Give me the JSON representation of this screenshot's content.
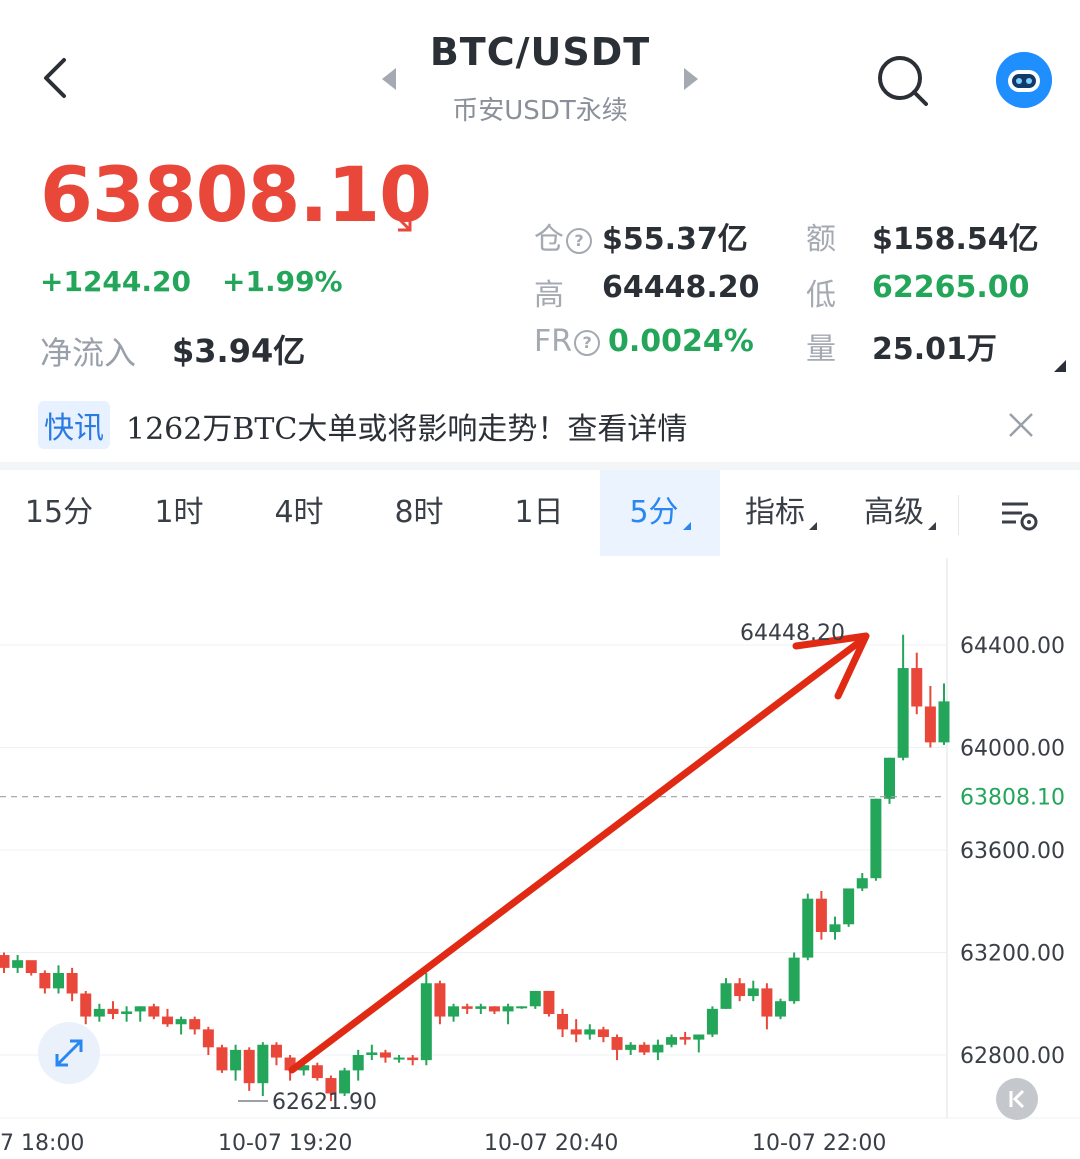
{
  "header": {
    "pair": "BTC/USDT",
    "exchange": "币安USDT永续"
  },
  "price": {
    "last": "63808.10",
    "change_abs": "+1244.20",
    "change_pct": "+1.99%",
    "netflow_label": "净流入",
    "netflow_value": "$3.94亿"
  },
  "stats": {
    "oi_label": "仓",
    "oi_value": "$55.37亿",
    "amount_label": "额",
    "amount_value": "$158.54亿",
    "high_label": "高",
    "high_value": "64448.20",
    "low_label": "低",
    "low_value": "62265.00",
    "fr_label": "FR",
    "fr_value": "0.0024%",
    "vol_label": "量",
    "vol_value": "25.01万"
  },
  "news": {
    "tag": "快讯",
    "text": "1262万BTC大单或将影响走势！查看详情"
  },
  "tabs": {
    "t15m": "15分",
    "t1h": "1时",
    "t4h": "4时",
    "t8h": "8时",
    "t1d": "1日",
    "t5m": "5分",
    "indicators": "指标",
    "advanced": "高级"
  },
  "colors": {
    "up": "#23a55a",
    "down": "#e8473a",
    "accent": "#2a86f0"
  },
  "chart_data": {
    "type": "candlestick",
    "y_ticks": [
      "64400.00",
      "64000.00",
      "63600.00",
      "63200.00",
      "62800.00"
    ],
    "y_tick_values": [
      64400,
      64000,
      63600,
      63200,
      62800
    ],
    "x_ticks": [
      "7 18:00",
      "10-07 19:20",
      "10-07 20:40",
      "10-07 22:00"
    ],
    "last_price_line": "63808.10",
    "high_marker": "64448.20",
    "low_marker": "62621.90",
    "ylim": [
      62580,
      64620
    ],
    "candles": [
      [
        63190,
        63200,
        63120,
        63140
      ],
      [
        63140,
        63190,
        63120,
        63170
      ],
      [
        63170,
        63160,
        63110,
        63120
      ],
      [
        63120,
        63130,
        63040,
        63060
      ],
      [
        63060,
        63150,
        63040,
        63120
      ],
      [
        63120,
        63140,
        63010,
        63040
      ],
      [
        63040,
        63050,
        62920,
        62950
      ],
      [
        62950,
        63000,
        62930,
        62980
      ],
      [
        62980,
        63010,
        62940,
        62960
      ],
      [
        62960,
        62990,
        62930,
        62970
      ],
      [
        62970,
        62990,
        62930,
        62990
      ],
      [
        62990,
        63000,
        62940,
        62950
      ],
      [
        62950,
        62980,
        62910,
        62920
      ],
      [
        62920,
        62950,
        62880,
        62940
      ],
      [
        62940,
        62950,
        62880,
        62900
      ],
      [
        62900,
        62910,
        62800,
        62830
      ],
      [
        62830,
        62840,
        62730,
        62740
      ],
      [
        62740,
        62840,
        62700,
        62820
      ],
      [
        62820,
        62830,
        62660,
        62690
      ],
      [
        62690,
        62850,
        62640,
        62840
      ],
      [
        62840,
        62850,
        62760,
        62790
      ],
      [
        62790,
        62800,
        62700,
        62740
      ],
      [
        62740,
        62780,
        62720,
        62760
      ],
      [
        62760,
        62770,
        62700,
        62710
      ],
      [
        62710,
        62720,
        62620,
        62650
      ],
      [
        62650,
        62750,
        62640,
        62740
      ],
      [
        62740,
        62820,
        62700,
        62800
      ],
      [
        62800,
        62840,
        62780,
        62810
      ],
      [
        62810,
        62820,
        62770,
        62790
      ],
      [
        62790,
        62800,
        62770,
        62790
      ],
      [
        62790,
        62800,
        62760,
        62780
      ],
      [
        62780,
        63120,
        62760,
        63080
      ],
      [
        63080,
        63090,
        62920,
        62950
      ],
      [
        62950,
        63000,
        62930,
        62990
      ],
      [
        62990,
        63000,
        62960,
        62980
      ],
      [
        62980,
        63000,
        62960,
        62990
      ],
      [
        62990,
        62990,
        62960,
        62970
      ],
      [
        62970,
        63000,
        62920,
        62990
      ],
      [
        62990,
        62990,
        62980,
        62990
      ],
      [
        62990,
        63050,
        62980,
        63050
      ],
      [
        63050,
        63050,
        62950,
        62960
      ],
      [
        62960,
        62980,
        62870,
        62900
      ],
      [
        62900,
        62940,
        62850,
        62880
      ],
      [
        62880,
        62920,
        62860,
        62900
      ],
      [
        62900,
        62910,
        62850,
        62870
      ],
      [
        62870,
        62880,
        62780,
        62820
      ],
      [
        62820,
        62850,
        62800,
        62840
      ],
      [
        62840,
        62850,
        62800,
        62810
      ],
      [
        62810,
        62860,
        62780,
        62840
      ],
      [
        62840,
        62880,
        62830,
        62870
      ],
      [
        62870,
        62890,
        62840,
        62860
      ],
      [
        62860,
        62880,
        62810,
        62880
      ],
      [
        62880,
        62990,
        62870,
        62980
      ],
      [
        62980,
        63100,
        62980,
        63080
      ],
      [
        63080,
        63100,
        63010,
        63030
      ],
      [
        63030,
        63090,
        63010,
        63060
      ],
      [
        63060,
        63080,
        62900,
        62950
      ],
      [
        62950,
        63020,
        62940,
        63010
      ],
      [
        63010,
        63200,
        63000,
        63180
      ],
      [
        63180,
        63430,
        63170,
        63410
      ],
      [
        63410,
        63440,
        63250,
        63280
      ],
      [
        63280,
        63340,
        63250,
        63310
      ],
      [
        63310,
        63400,
        63300,
        63450
      ],
      [
        63450,
        63510,
        63440,
        63490
      ],
      [
        63490,
        63800,
        63480,
        63800
      ],
      [
        63800,
        63960,
        63780,
        63960
      ],
      [
        63960,
        64440,
        63950,
        64310
      ],
      [
        64310,
        64370,
        64130,
        64160
      ],
      [
        64160,
        64240,
        64000,
        64020
      ],
      [
        64020,
        64250,
        64010,
        64180
      ]
    ]
  }
}
